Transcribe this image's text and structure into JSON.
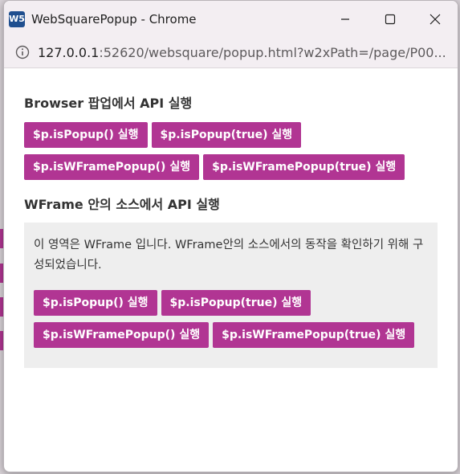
{
  "window": {
    "icon_label": "W5",
    "title": "WebSquarePopup - Chrome"
  },
  "address": {
    "host": "127.0.0.1",
    "rest": ":52620/websquare/popup.html?w2xPath=/page/P00..."
  },
  "browser_section": {
    "title": "Browser 팝업에서 API 실행",
    "buttons": [
      "$p.isPopup() 실행",
      "$p.isPopup(true) 실행",
      "$p.isWFramePopup() 실행",
      "$p.isWFramePopup(true) 실행"
    ]
  },
  "wframe_section": {
    "title": "WFrame 안의 소스에서 API 실행",
    "description": "이 영역은 WFrame 입니다. WFrame안의 소스에서의 동작을 확인하기 위해 구성되었습니다.",
    "buttons": [
      "$p.isPopup() 실행",
      "$p.isPopup(true) 실행",
      "$p.isWFramePopup() 실행",
      "$p.isWFramePopup(true) 실행"
    ]
  },
  "colors": {
    "button": "#b13593",
    "titlebar": "#f3eef2",
    "frame_bg": "#eeeeee"
  }
}
